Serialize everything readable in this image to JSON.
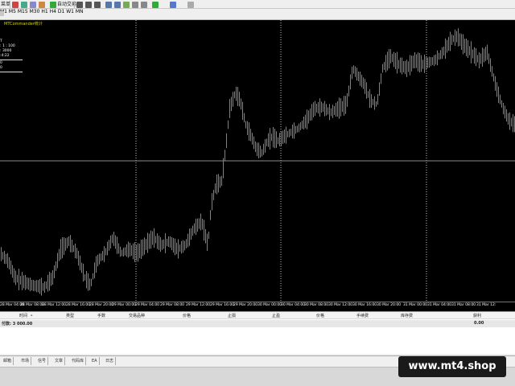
{
  "toolbar": {
    "menu_label": "菜单",
    "timeframes": [
      "M1",
      "M5",
      "M15",
      "M30",
      "H1",
      "H4",
      "D1",
      "W1",
      "MN"
    ],
    "autotrade_label": "自动交易"
  },
  "chart": {
    "ea_title": "MTCommander统计",
    "ea_panel_lines": [
      "T",
      ": 1 : 100",
      ": 3000",
      ":4:22",
      "0",
      "0"
    ],
    "colors": {
      "background": "#000000",
      "candles": "#00dd00",
      "grid_vertical": "#ffffff",
      "price_line": "#8a8a8a"
    }
  },
  "date_axis": {
    "labels": [
      "28 Mar 04:00",
      "28 Mar 08:00",
      "28 Mar 12:00",
      "28 Mar 16:00",
      "28 Mar 20:00",
      "29 Mar 00:00",
      "29 Mar 04:00",
      "29 Mar 08:00",
      "29 Mar 12:00",
      "29 Mar 16:00",
      "29 Mar 20:00",
      "30 Mar 00:00",
      "30 Mar 04:00",
      "30 Mar 08:00",
      "30 Mar 12:00",
      "30 Mar 16:00",
      "30 Mar 20:00",
      "31 Mar 00:00",
      "31 Mar 04:00",
      "31 Mar 08:00",
      "31 Mar 12:"
    ]
  },
  "terminal": {
    "columns": [
      "时间",
      "类型",
      "手数",
      "交易品种",
      "价格",
      "止损",
      "止盈",
      "价格",
      "手续费",
      "库存费",
      "获利"
    ],
    "balance_label": "付款: 3 000.00",
    "profit_total": "0.00"
  },
  "tabs": [
    "邮箱",
    "市场",
    "信号",
    "文章",
    "代码库",
    "EA",
    "日志"
  ],
  "watermark": "www.mt4.shop"
}
